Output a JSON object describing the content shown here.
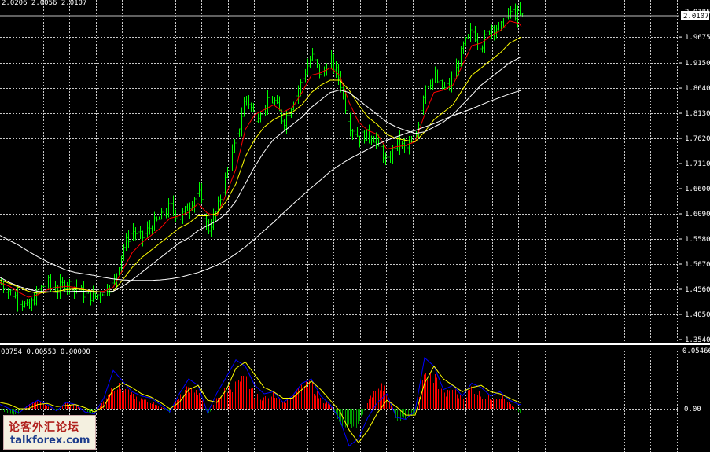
{
  "window": {
    "price_header": "2.0206 2.0056 2.0107",
    "osc_header": "00754 0.00553 0.00000"
  },
  "watermark": {
    "cn_text": "论客外汇论坛",
    "en_text": "talkforex.com"
  },
  "colors": {
    "background": "#000000",
    "grid": "#c8c8c8",
    "bar": "#00ff00",
    "ma_fast": "#ff0000",
    "ma_mid": "#ffff00",
    "ma_slow": "#ffffff",
    "ma_long": "#ffffff",
    "hist_pos": "#ff0000",
    "hist_neg": "#00a000",
    "macd": "#0000ff",
    "signal": "#ffff00",
    "price_tag_bg": "#ffffff"
  },
  "chart_data": [
    {
      "type": "line",
      "ylim": [
        1.354,
        2.0107
      ],
      "yticks": [
        "1.9675",
        "1.9150",
        "1.8640",
        "1.8130",
        "1.7620",
        "1.7110",
        "1.6600",
        "1.6090",
        "1.5580",
        "1.5070",
        "1.4560",
        "1.4050",
        "1.3540"
      ],
      "top_tick": "2.0185",
      "current_price": "2.0107",
      "x_segments": [
        0,
        12,
        24,
        36,
        48,
        60,
        72,
        84,
        96,
        108,
        120,
        132,
        144,
        156,
        168,
        180,
        192,
        204,
        216,
        228,
        240,
        252,
        264,
        276,
        288,
        300,
        312,
        324,
        336,
        348,
        360,
        372,
        384,
        396,
        408,
        420,
        432,
        444,
        456,
        468,
        480,
        492,
        504,
        516,
        528,
        540,
        552,
        564,
        576,
        588,
        600,
        612,
        624,
        636,
        648,
        660,
        665
      ],
      "close": [
        1.468,
        1.452,
        1.435,
        1.415,
        1.452,
        1.47,
        1.455,
        1.47,
        1.46,
        1.445,
        1.44,
        1.455,
        1.465,
        1.54,
        1.575,
        1.56,
        1.585,
        1.6,
        1.625,
        1.6,
        1.625,
        1.655,
        1.575,
        1.618,
        1.69,
        1.755,
        1.85,
        1.805,
        1.83,
        1.84,
        1.795,
        1.835,
        1.88,
        1.93,
        1.89,
        1.92,
        1.88,
        1.79,
        1.765,
        1.77,
        1.758,
        1.71,
        1.755,
        1.74,
        1.76,
        1.87,
        1.885,
        1.86,
        1.88,
        1.945,
        1.98,
        1.95,
        1.99,
        1.985,
        2.02,
        2.01,
        2.01
      ],
      "series": [
        {
          "key": "ma_fast",
          "values": [
            1.47,
            1.462,
            1.45,
            1.44,
            1.445,
            1.455,
            1.46,
            1.462,
            1.46,
            1.455,
            1.45,
            1.452,
            1.46,
            1.495,
            1.53,
            1.55,
            1.565,
            1.58,
            1.6,
            1.605,
            1.612,
            1.63,
            1.61,
            1.605,
            1.65,
            1.7,
            1.78,
            1.81,
            1.82,
            1.83,
            1.815,
            1.825,
            1.855,
            1.89,
            1.895,
            1.905,
            1.89,
            1.835,
            1.795,
            1.778,
            1.77,
            1.74,
            1.745,
            1.748,
            1.755,
            1.81,
            1.855,
            1.86,
            1.87,
            1.91,
            1.95,
            1.955,
            1.97,
            1.98,
            2.0,
            1.995,
            1.985
          ]
        },
        {
          "key": "ma_mid",
          "values": [
            1.475,
            1.468,
            1.46,
            1.452,
            1.448,
            1.45,
            1.452,
            1.455,
            1.457,
            1.455,
            1.452,
            1.45,
            1.452,
            1.475,
            1.5,
            1.52,
            1.535,
            1.55,
            1.565,
            1.58,
            1.59,
            1.605,
            1.605,
            1.61,
            1.635,
            1.67,
            1.725,
            1.76,
            1.785,
            1.8,
            1.81,
            1.815,
            1.83,
            1.855,
            1.87,
            1.88,
            1.88,
            1.86,
            1.83,
            1.805,
            1.79,
            1.77,
            1.762,
            1.758,
            1.755,
            1.775,
            1.8,
            1.815,
            1.83,
            1.86,
            1.89,
            1.905,
            1.92,
            1.935,
            1.955,
            1.965,
            1.97
          ]
        },
        {
          "key": "ma_slow",
          "values": [
            1.48,
            1.47,
            1.462,
            1.456,
            1.452,
            1.451,
            1.45,
            1.451,
            1.452,
            1.452,
            1.451,
            1.45,
            1.452,
            1.462,
            1.475,
            1.49,
            1.505,
            1.52,
            1.535,
            1.55,
            1.56,
            1.575,
            1.585,
            1.595,
            1.61,
            1.635,
            1.67,
            1.705,
            1.735,
            1.76,
            1.775,
            1.79,
            1.805,
            1.825,
            1.84,
            1.855,
            1.86,
            1.855,
            1.84,
            1.825,
            1.81,
            1.795,
            1.785,
            1.778,
            1.772,
            1.775,
            1.785,
            1.795,
            1.81,
            1.83,
            1.85,
            1.87,
            1.885,
            1.9,
            1.915,
            1.925,
            1.93
          ]
        },
        {
          "key": "ma_long",
          "values": [
            1.565,
            1.555,
            1.545,
            1.533,
            1.522,
            1.512,
            1.503,
            1.495,
            1.49,
            1.487,
            1.484,
            1.48,
            1.477,
            1.475,
            1.474,
            1.474,
            1.474,
            1.475,
            1.477,
            1.48,
            1.485,
            1.49,
            1.497,
            1.505,
            1.515,
            1.528,
            1.542,
            1.558,
            1.575,
            1.592,
            1.61,
            1.628,
            1.645,
            1.662,
            1.678,
            1.695,
            1.708,
            1.72,
            1.73,
            1.74,
            1.75,
            1.758,
            1.765,
            1.772,
            1.778,
            1.785,
            1.792,
            1.8,
            1.808,
            1.815,
            1.822,
            1.83,
            1.838,
            1.845,
            1.852,
            1.858,
            1.86
          ]
        }
      ]
    },
    {
      "type": "bar",
      "ylim": [
        -0.05466,
        0.05466
      ],
      "yticks": [
        "0.05466",
        "0.00"
      ],
      "x_segments": [
        0,
        12,
        24,
        36,
        48,
        60,
        72,
        84,
        96,
        108,
        120,
        132,
        144,
        156,
        168,
        180,
        192,
        204,
        216,
        228,
        240,
        252,
        264,
        276,
        288,
        300,
        312,
        324,
        336,
        348,
        360,
        372,
        384,
        396,
        408,
        420,
        432,
        444,
        456,
        468,
        480,
        492,
        504,
        516,
        528,
        540,
        552,
        564,
        576,
        588,
        600,
        612,
        624,
        636,
        648,
        660
      ],
      "histogram": [
        0.0,
        -0.006,
        -0.004,
        0.004,
        0.007,
        0.002,
        -0.002,
        0.005,
        0.003,
        -0.002,
        -0.005,
        0.008,
        0.022,
        0.018,
        0.012,
        0.008,
        0.006,
        0.002,
        -0.004,
        0.012,
        0.02,
        0.015,
        -0.006,
        0.01,
        0.018,
        0.022,
        0.028,
        0.012,
        0.01,
        0.014,
        0.006,
        0.01,
        0.02,
        0.022,
        0.008,
        0.003,
        -0.012,
        -0.018,
        -0.014,
        0.006,
        0.024,
        0.016,
        -0.01,
        -0.008,
        -0.004,
        0.032,
        0.03,
        0.012,
        0.018,
        0.008,
        0.02,
        0.012,
        0.01,
        0.012,
        0.005,
        -0.004
      ],
      "series": [
        {
          "key": "macd",
          "values": [
            0.004,
            0.0,
            -0.004,
            0.003,
            0.008,
            0.004,
            -0.002,
            0.006,
            0.004,
            -0.003,
            -0.005,
            0.01,
            0.036,
            0.026,
            0.016,
            0.012,
            0.01,
            0.004,
            -0.003,
            0.014,
            0.028,
            0.022,
            -0.004,
            0.015,
            0.03,
            0.046,
            0.04,
            0.022,
            0.014,
            0.016,
            0.006,
            0.012,
            0.024,
            0.028,
            0.012,
            0.004,
            -0.01,
            -0.035,
            -0.028,
            -0.008,
            0.006,
            0.014,
            -0.008,
            -0.01,
            -0.002,
            0.048,
            0.04,
            0.018,
            0.022,
            0.012,
            0.024,
            0.02,
            0.012,
            0.016,
            0.008,
            0.004
          ]
        },
        {
          "key": "signal",
          "values": [
            0.006,
            0.004,
            0.0,
            0.0,
            0.004,
            0.005,
            0.002,
            0.003,
            0.004,
            0.001,
            -0.003,
            0.002,
            0.018,
            0.024,
            0.02,
            0.014,
            0.011,
            0.006,
            0.0,
            0.006,
            0.018,
            0.022,
            0.008,
            0.006,
            0.018,
            0.038,
            0.044,
            0.032,
            0.02,
            0.016,
            0.01,
            0.01,
            0.018,
            0.026,
            0.018,
            0.008,
            -0.002,
            -0.02,
            -0.032,
            -0.02,
            -0.004,
            0.008,
            0.002,
            -0.006,
            -0.006,
            0.024,
            0.04,
            0.028,
            0.022,
            0.016,
            0.02,
            0.022,
            0.016,
            0.014,
            0.01,
            0.006
          ]
        }
      ]
    }
  ]
}
